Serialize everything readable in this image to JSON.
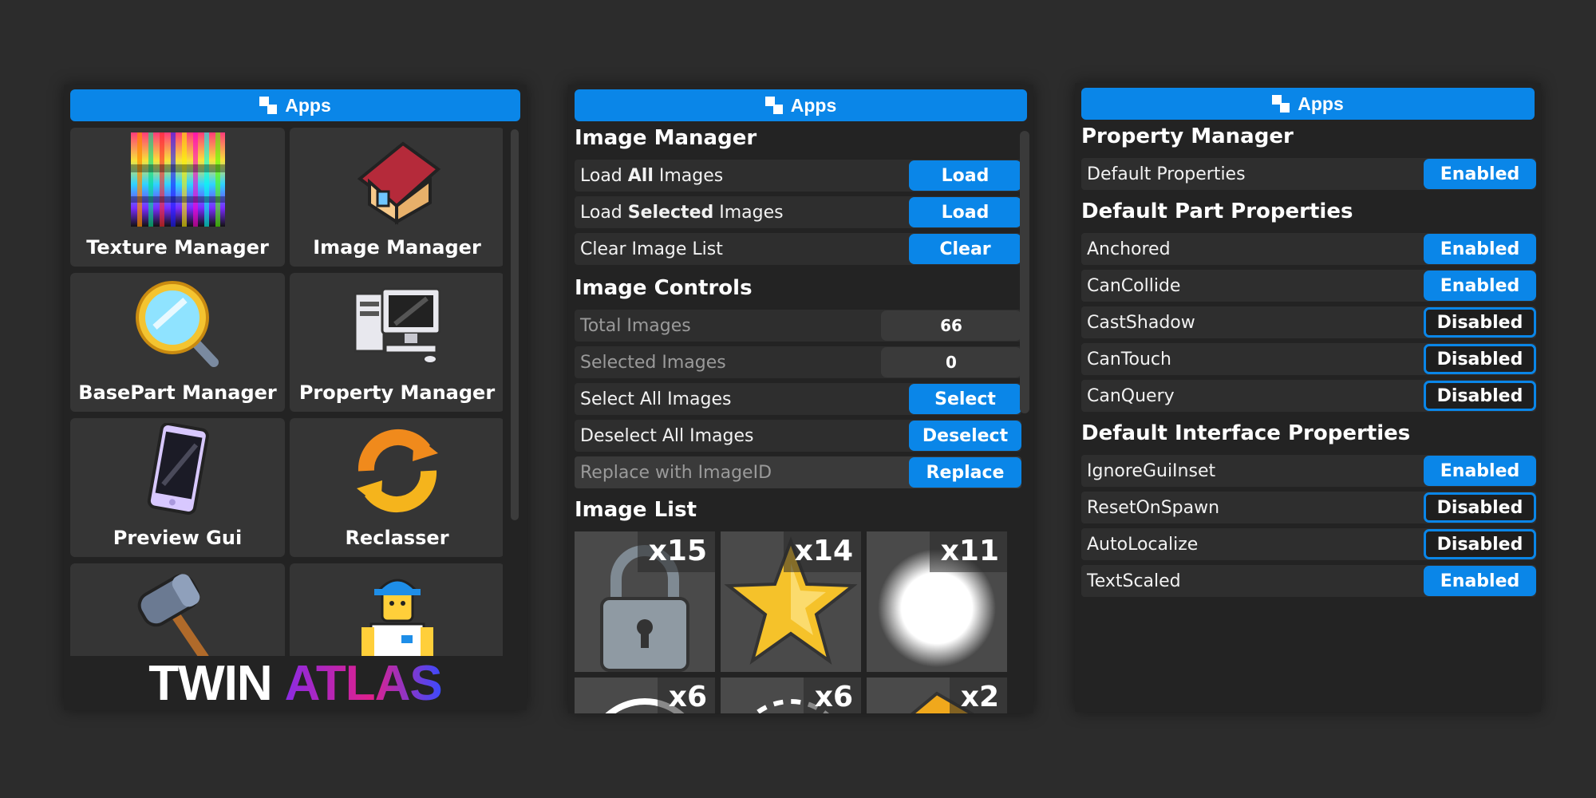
{
  "panels": {
    "apps_grid": {
      "title": "Apps",
      "tiles": [
        {
          "label": "Texture Manager",
          "icon": "texture-swatch-icon"
        },
        {
          "label": "Image Manager",
          "icon": "house-icon"
        },
        {
          "label": "BasePart Manager",
          "icon": "magnifier-icon"
        },
        {
          "label": "Property Manager",
          "icon": "computer-icon"
        },
        {
          "label": "Preview Gui",
          "icon": "phone-icon"
        },
        {
          "label": "Reclasser",
          "icon": "refresh-icon"
        },
        {
          "label": "",
          "icon": "hammer-icon"
        },
        {
          "label": "",
          "icon": "worker-icon"
        }
      ],
      "brand": {
        "word1": "TWIN",
        "word2": "ATLAS"
      }
    },
    "image_manager": {
      "title": "Apps",
      "heading_manager": "Image Manager",
      "load_all": {
        "pre": "Load ",
        "bold": "All",
        "post": " Images",
        "button": "Load"
      },
      "load_selected": {
        "pre": "Load ",
        "bold": "Selected",
        "post": " Images",
        "button": "Load"
      },
      "clear": {
        "label": "Clear Image List",
        "button": "Clear"
      },
      "heading_controls": "Image Controls",
      "total": {
        "label": "Total Images",
        "value": "66"
      },
      "selected": {
        "label": "Selected Images",
        "value": "0"
      },
      "select_all": {
        "label": "Select All Images",
        "button": "Select"
      },
      "deselect_all": {
        "label": "Deselect All Images",
        "button": "Deselect"
      },
      "replace": {
        "placeholder": "Replace with ImageID",
        "button": "Replace"
      },
      "heading_list": "Image List",
      "images": [
        {
          "count": "x15",
          "icon": "lock-icon"
        },
        {
          "count": "x14",
          "icon": "star-icon"
        },
        {
          "count": "x11",
          "icon": "glow-circle-icon"
        },
        {
          "count": "x6",
          "icon": "ring-icon"
        },
        {
          "count": "x6",
          "icon": "dashed-ring-icon"
        },
        {
          "count": "x2",
          "icon": "gold-item-icon"
        }
      ]
    },
    "property_manager": {
      "title": "Apps",
      "heading_manager": "Property Manager",
      "default_properties": {
        "label": "Default Properties",
        "button": "Enabled"
      },
      "heading_part": "Default Part Properties",
      "part_properties": [
        {
          "label": "Anchored",
          "button": "Enabled",
          "state": "enabled"
        },
        {
          "label": "CanCollide",
          "button": "Enabled",
          "state": "enabled"
        },
        {
          "label": "CastShadow",
          "button": "Disabled",
          "state": "disabled"
        },
        {
          "label": "CanTouch",
          "button": "Disabled",
          "state": "disabled"
        },
        {
          "label": "CanQuery",
          "button": "Disabled",
          "state": "disabled"
        }
      ],
      "heading_interface": "Default Interface Properties",
      "interface_properties": [
        {
          "label": "IgnoreGuiInset",
          "button": "Enabled",
          "state": "enabled"
        },
        {
          "label": "ResetOnSpawn",
          "button": "Disabled",
          "state": "disabled"
        },
        {
          "label": "AutoLocalize",
          "button": "Disabled",
          "state": "disabled"
        },
        {
          "label": "TextScaled",
          "button": "Enabled",
          "state": "enabled"
        }
      ]
    }
  },
  "colors": {
    "accent": "#0a86e8",
    "background": "#2c2c2c",
    "panel": "#232323",
    "tile": "#353535"
  }
}
